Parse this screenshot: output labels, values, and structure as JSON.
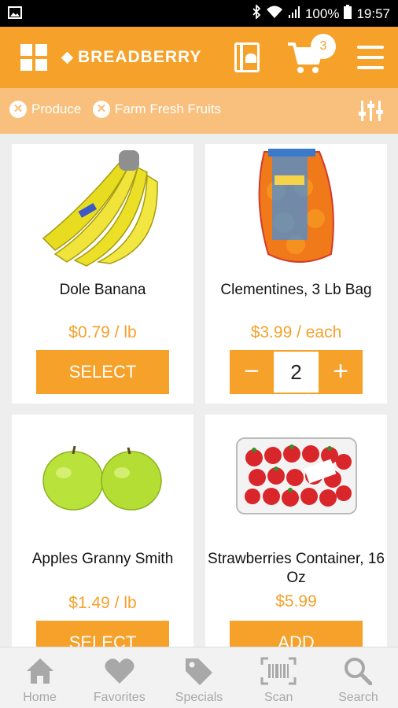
{
  "status_bar": {
    "battery": "100%",
    "time": "19:57"
  },
  "header": {
    "brand": "BREADBERRY",
    "cart_count": "3"
  },
  "filters": [
    {
      "label": "Produce"
    },
    {
      "label": "Farm Fresh Fruits"
    }
  ],
  "products": [
    {
      "name": "Dole Banana",
      "price": "$0.79 / lb",
      "action": "SELECT"
    },
    {
      "name": "Clementines, 3 Lb Bag",
      "price": "$3.99 / each",
      "quantity": "2",
      "minus": "−",
      "plus": "+"
    },
    {
      "name": "Apples Granny Smith",
      "price": "$1.49 / lb",
      "action": "SELECT"
    },
    {
      "name": "Strawberries Container, 16 Oz",
      "price": "$5.99",
      "action": "ADD"
    }
  ],
  "bottom_nav": [
    {
      "label": "Home",
      "icon": "home-icon"
    },
    {
      "label": "Favorites",
      "icon": "heart-icon"
    },
    {
      "label": "Specials",
      "icon": "tag-icon"
    },
    {
      "label": "Scan",
      "icon": "barcode-icon"
    },
    {
      "label": "Search",
      "icon": "search-icon"
    }
  ],
  "colors": {
    "accent": "#f5a12a",
    "filter_bar": "#f8c07c",
    "nav_inactive": "#a8a8a8"
  }
}
